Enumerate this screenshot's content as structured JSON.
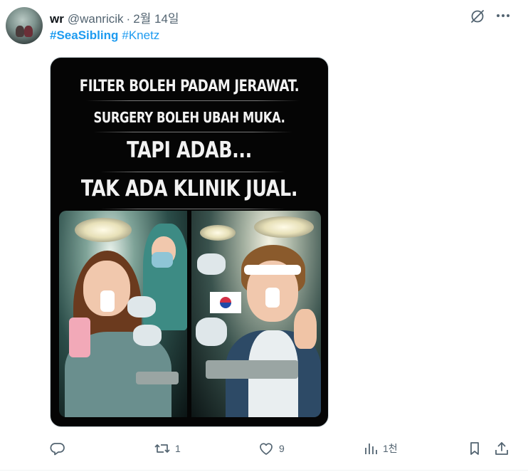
{
  "tweet": {
    "author_name": "wr",
    "handle": "@wanricik",
    "separator": "·",
    "date": "2월 14일",
    "hashtags": [
      "#SeaSibling",
      "#Knetz"
    ]
  },
  "media": {
    "caption_lines": [
      "FILTER BOLEH PADAM JERAWAT.",
      "SURGERY BOLEH UBAH MUKA.",
      "TAPI ADAB...",
      "TAK ADA KLINIK JUAL."
    ]
  },
  "actions": {
    "reply": {
      "icon": "reply-icon",
      "count": ""
    },
    "retweet": {
      "icon": "retweet-icon",
      "count": "1"
    },
    "like": {
      "icon": "heart-icon",
      "count": "9"
    },
    "views": {
      "icon": "views-icon",
      "count": "1천"
    },
    "bookmark": {
      "icon": "bookmark-icon"
    },
    "share": {
      "icon": "share-icon"
    }
  },
  "colors": {
    "link": "#1d9bf0",
    "secondary_text": "#536471",
    "primary_text": "#0f1419"
  }
}
